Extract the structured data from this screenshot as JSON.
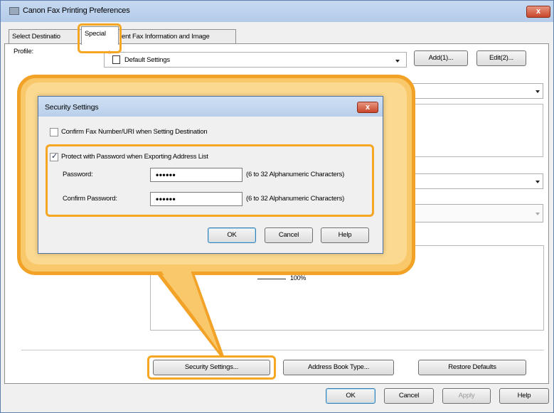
{
  "window": {
    "title": "Canon Fax Printing Preferences",
    "close": "x"
  },
  "tabs": [
    "Select Destinatio",
    "Special",
    "ent Fax Information and Image"
  ],
  "profile": {
    "label": "Profile:",
    "value": "Default Settings",
    "add": "Add(1)...",
    "edit": "Edit(2)..."
  },
  "background": {
    "zoom": "100%"
  },
  "dialog": {
    "title": "Security Settings",
    "close": "x",
    "confirm_fax_label": "Confirm Fax Number/URI when Setting Destination",
    "confirm_fax_checked": false,
    "protect_label": "Protect with Password when Exporting Address List",
    "protect_checked": true,
    "password_label": "Password:",
    "password_value": "••••••",
    "password_hint": "(6 to 32 Alphanumeric Characters)",
    "confirm_password_label": "Confirm Password:",
    "confirm_password_value": "••••••",
    "confirm_password_hint": "(6 to 32 Alphanumeric Characters)",
    "ok": "OK",
    "cancel": "Cancel",
    "help": "Help"
  },
  "bottom_buttons": {
    "security": "Security Settings...",
    "address_book": "Address Book Type...",
    "restore": "Restore Defaults"
  },
  "footer": {
    "ok": "OK",
    "cancel": "Cancel",
    "apply": "Apply",
    "help": "Help"
  },
  "colors": {
    "highlight": "#f5a623",
    "callout_fill": "#f9c86a",
    "title_bar": "#c6d9f1"
  }
}
